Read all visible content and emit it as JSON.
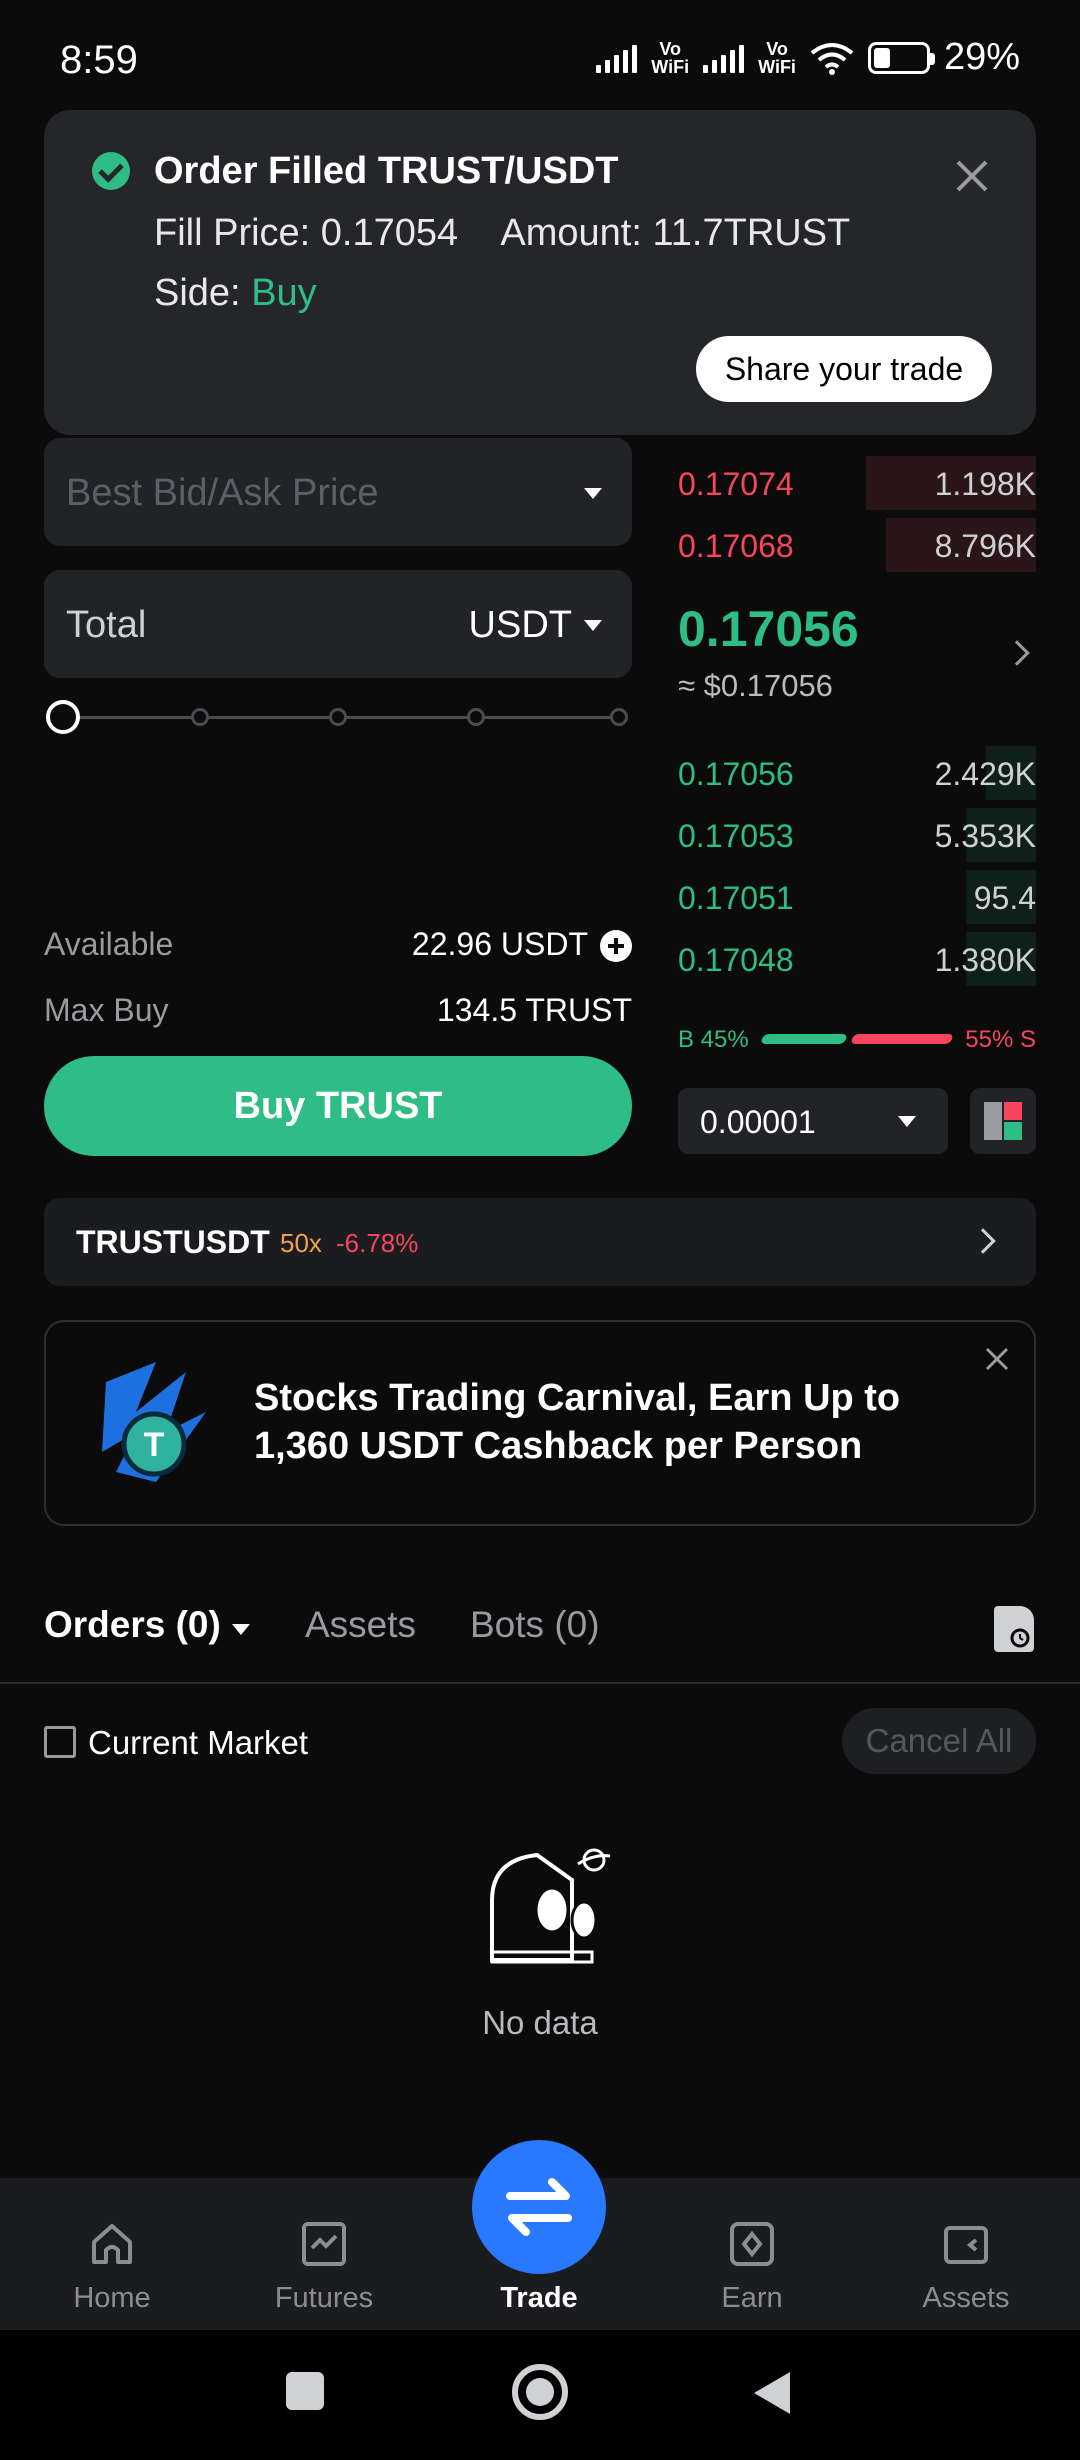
{
  "status_bar": {
    "time": "8:59",
    "net1": "Vo\nWiFi",
    "net2": "Vo\nWiFi",
    "battery": "29%"
  },
  "notification": {
    "title": "Order Filled TRUST/USDT",
    "fill_price": "Fill Price: 0.17054",
    "amount": "Amount: 11.7TRUST",
    "side_label": "Side:",
    "side_value": "Buy",
    "share_label": "Share your trade"
  },
  "form": {
    "price_placeholder": "Best Bid/Ask Price",
    "total_label": "Total",
    "total_unit": "USDT",
    "slider_percent": 0,
    "available_label": "Available",
    "available_value": "22.96 USDT",
    "maxbuy_label": "Max Buy",
    "maxbuy_value": "134.5 TRUST",
    "buy_button": "Buy TRUST"
  },
  "orderbook": {
    "asks": [
      {
        "price": "0.17074",
        "qty": "1.198K"
      },
      {
        "price": "0.17068",
        "qty": "8.796K"
      }
    ],
    "last_price": "0.17056",
    "last_usd": "≈ $0.17056",
    "bids": [
      {
        "price": "0.17056",
        "qty": "2.429K"
      },
      {
        "price": "0.17053",
        "qty": "5.353K"
      },
      {
        "price": "0.17051",
        "qty": "95.4"
      },
      {
        "price": "0.17048",
        "qty": "1.380K"
      }
    ],
    "buy_ratio": "B 45%",
    "sell_ratio": "55% S",
    "precision": "0.00001"
  },
  "ticker": {
    "symbol": "TRUSTUSDT",
    "leverage": "50x",
    "change": "-6.78%"
  },
  "banner": {
    "text": "Stocks Trading Carnival, Earn Up to 1,360 USDT Cashback per Person"
  },
  "tabs": {
    "orders": "Orders (0)",
    "assets": "Assets",
    "bots": "Bots (0)"
  },
  "orders": {
    "current_market": "Current Market",
    "cancel_all": "Cancel All",
    "empty": "No data"
  },
  "bottom_nav": {
    "home": "Home",
    "futures": "Futures",
    "trade": "Trade",
    "earn": "Earn",
    "assets": "Assets"
  },
  "colors": {
    "buy": "#2ebd85",
    "sell": "#f6465d",
    "accent": "#2979ff"
  }
}
